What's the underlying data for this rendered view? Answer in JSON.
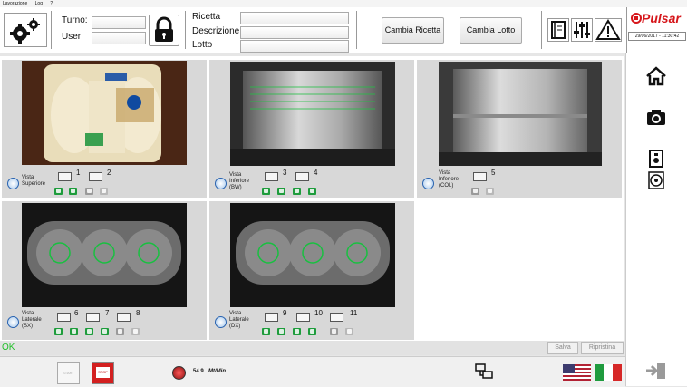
{
  "menu": [
    "Lavorazione",
    "Log",
    "?"
  ],
  "header": {
    "turno_label": "Turno:",
    "user_label": "User:",
    "ricetta_label": "Ricetta",
    "descrizione_label": "Descrizione",
    "lotto_label": "Lotto",
    "cambia_ricetta": "Cambia Ricetta",
    "cambia_lotto": "Cambia Lotto"
  },
  "brand": {
    "name": "Pulsar",
    "datetime": "29/06/2017 - 11:30:42",
    "color": "#d6161b"
  },
  "cameras": [
    {
      "label_lines": [
        "Vista",
        "Superiore"
      ],
      "monitors": [
        "1",
        "2"
      ]
    },
    {
      "label_lines": [
        "Vista",
        "Inferiore",
        "(BW)"
      ],
      "monitors": [
        "3",
        "4"
      ]
    },
    {
      "label_lines": [
        "Vista",
        "Inferiore",
        "(COL)"
      ],
      "monitors": [
        "5"
      ]
    },
    {
      "label_lines": [
        "Vista",
        "Laterale",
        "(SX)"
      ],
      "monitors": [
        "6",
        "7",
        "8"
      ]
    },
    {
      "label_lines": [
        "Vista",
        "Laterale",
        "(DX)"
      ],
      "monitors": [
        "9",
        "10",
        "11"
      ]
    }
  ],
  "status": {
    "text": "OK",
    "salva": "Salva",
    "ripristina": "Ripristina",
    "ok_color": "#22c02a"
  },
  "footer": {
    "start_label": "START",
    "stop_label": "STOP",
    "speed_value": "54.9",
    "speed_unit": "Mt/Min"
  },
  "sidebar_icons": [
    "home-icon",
    "camera-icon",
    "device-icon",
    "disk-icon",
    "logout-icon"
  ]
}
